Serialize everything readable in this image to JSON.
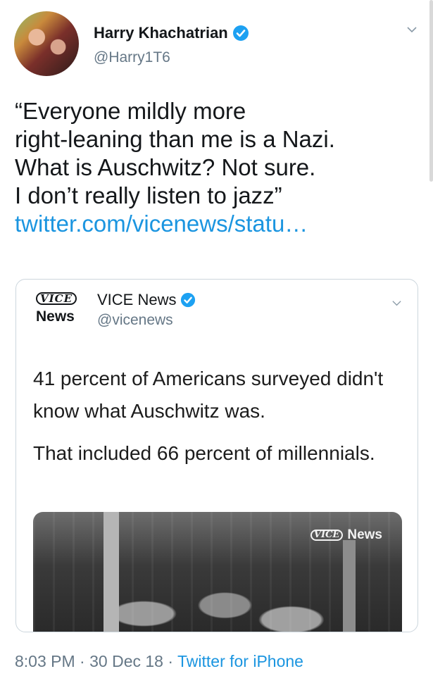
{
  "tweet": {
    "author_name": "Harry Khachatrian",
    "author_handle": "@Harry1T6",
    "text": "“Everyone mildly more\nright-leaning than me is a Nazi.\nWhat is Auschwitz? Not sure.\nI don’t really listen to jazz”",
    "link": "twitter.com/vicenews/statu…",
    "time": "8:03 PM",
    "date": "30 Dec 18",
    "separator": " · ",
    "source": "Twitter for iPhone"
  },
  "quoted": {
    "logo_top": "VICE",
    "logo_bottom": "News",
    "name": "VICE News",
    "handle": "@vicenews",
    "text_line1": "41 percent of Americans surveyed didn't know what Auschwitz was.",
    "text_line2": "That included 66 percent of millennials.",
    "media_watermark_logo": "VICE",
    "media_watermark_text": "News"
  },
  "icons": {
    "verified": "verified-badge-icon",
    "caret": "chevron-down-icon"
  },
  "colors": {
    "link": "#1b95e0",
    "secondary": "#657786",
    "verified": "#1da1f2"
  }
}
